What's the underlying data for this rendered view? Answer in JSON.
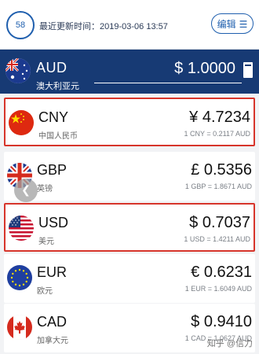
{
  "header": {
    "counter": "58",
    "last_update_label": "最近更新时间：",
    "last_update_time": "2019-03-06 13:57",
    "edit_label": "编辑"
  },
  "base": {
    "code": "AUD",
    "name": "澳大利亚元",
    "amount": "$ 1.0000"
  },
  "rows": [
    {
      "code": "CNY",
      "name": "中国人民币",
      "amount": "¥ 4.7234",
      "rate": "1 CNY = 0.2117 AUD",
      "highlighted": true
    },
    {
      "code": "GBP",
      "name": "英镑",
      "amount": "£ 0.5356",
      "rate": "1 GBP = 1.8671 AUD",
      "highlighted": false
    },
    {
      "code": "USD",
      "name": "美元",
      "amount": "$ 0.7037",
      "rate": "1 USD = 1.4211 AUD",
      "highlighted": true
    },
    {
      "code": "EUR",
      "name": "欧元",
      "amount": "€ 0.6231",
      "rate": "1 EUR = 1.6049 AUD",
      "highlighted": false
    },
    {
      "code": "CAD",
      "name": "加拿大元",
      "amount": "$ 0.9410",
      "rate": "1 CAD = 1.0627 AUD",
      "highlighted": false
    }
  ],
  "icons": {
    "edit_icon": "list-icon",
    "scroll_left": "chevron-left-icon",
    "calculator": "calculator-icon"
  },
  "watermark": "知乎 @信力",
  "colors": {
    "header_bg": "#ffffff",
    "accent_blue": "#1f5fae",
    "base_bar": "#173a74",
    "highlight_border": "#d7352b"
  }
}
